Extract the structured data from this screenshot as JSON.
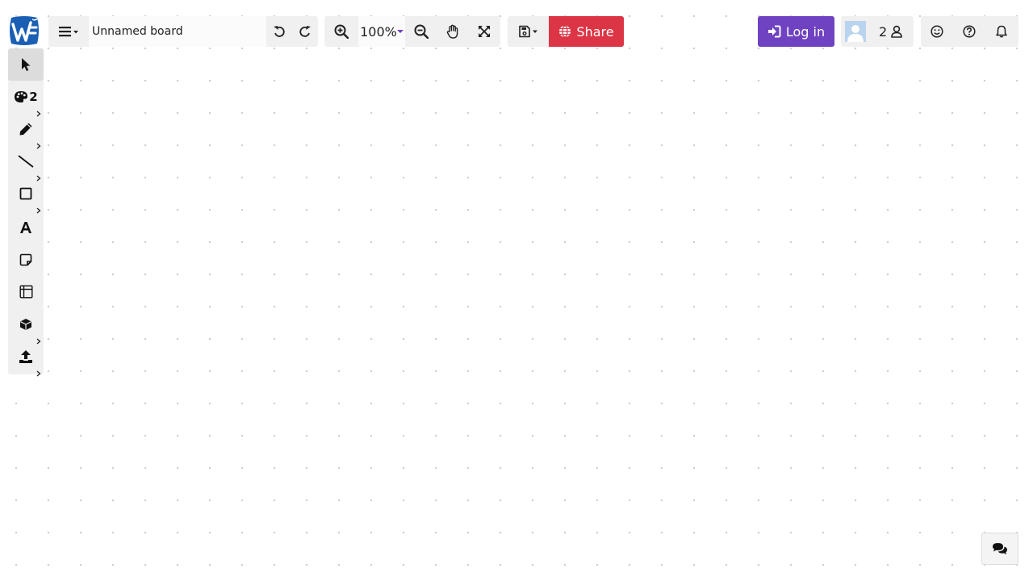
{
  "app": {
    "logo_icon": "wbo-logo-icon",
    "accent_blue": "#1a5fb4"
  },
  "header": {
    "menu_icon": "bars-icon",
    "board_name": "Unnamed board",
    "undo_icon": "undo-icon",
    "redo_icon": "redo-icon",
    "zoom_in_icon": "zoom-in-icon",
    "zoom_level": "100%",
    "zoom_out_icon": "zoom-out-icon",
    "hand_icon": "hand-icon",
    "fit_icon": "expand-icon",
    "save_icon": "floppy-icon",
    "share_label": "Share",
    "share_color": "#dc3545",
    "login_label": "Log in",
    "login_color": "#6f42c1",
    "user_count": "2"
  },
  "toolbar": {
    "tools": [
      {
        "name": "pointer",
        "icon": "pointer-icon",
        "active": true
      },
      {
        "name": "color",
        "icon": "palette-icon",
        "label": "2"
      },
      {
        "name": "pencil",
        "icon": "pencil-icon"
      },
      {
        "name": "line",
        "icon": "line-icon"
      },
      {
        "name": "rectangle",
        "icon": "square-icon"
      },
      {
        "name": "text",
        "icon": "text-icon"
      },
      {
        "name": "sticky-note",
        "icon": "note-icon"
      },
      {
        "name": "table",
        "icon": "table-icon"
      },
      {
        "name": "3d-shape",
        "icon": "cube-icon"
      },
      {
        "name": "upload",
        "icon": "upload-icon"
      }
    ]
  },
  "chat": {
    "icon": "comments-icon"
  }
}
